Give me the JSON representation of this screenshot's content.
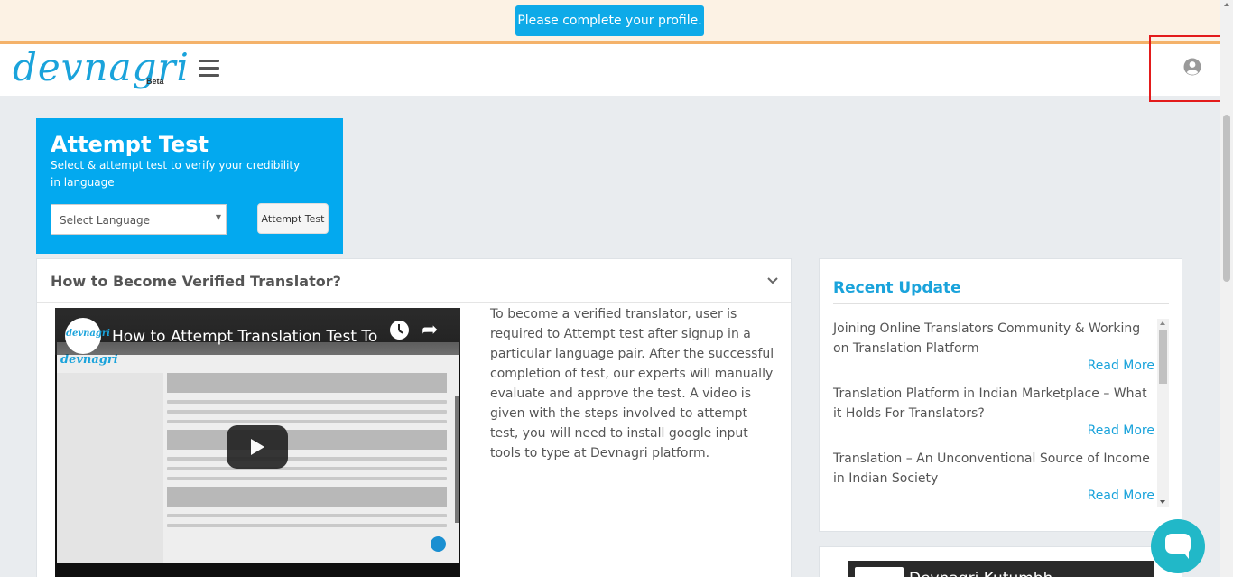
{
  "notice": {
    "button_label": "Please complete your profile."
  },
  "header": {
    "logo_text": "devnagri",
    "logo_badge": "Beta",
    "menu_icon": "hamburger-menu-icon",
    "profile_icon": "user-avatar-icon"
  },
  "attempt_test": {
    "title": "Attempt Test",
    "subtitle": "Select & attempt test to verify your credibility in language",
    "select_placeholder": "Select Language",
    "button_label": "Attempt Test"
  },
  "howto": {
    "title": "How to Become Verified Translator?",
    "chevron_icon": "chevron-down-icon",
    "video": {
      "title": "How to Attempt Translation Test To",
      "channel_logo": "devnagri"
    },
    "description": "To become a verified translator, user is required to Attempt test after signup in a particular language pair. After the successful completion of test, our experts will manually evaluate and approve the test. A video is given with the steps involved to attempt test, you will need to install google input tools to type at Devnagri platform."
  },
  "recent_update": {
    "title": "Recent Update",
    "items": [
      {
        "title": "Joining Online Translators Community & Working on Translation Platform",
        "link": "Read More"
      },
      {
        "title": "Translation Platform in Indian Marketplace – What it Holds For Translators?",
        "link": "Read More"
      },
      {
        "title": "Translation – An Unconventional Source of Income in Indian Society",
        "link": "Read More"
      }
    ]
  },
  "kutumbh": {
    "video_title": "Devnagri Kutumbh"
  },
  "colors": {
    "accent": "#03a9ef",
    "notice_bg": "#fcf2e4",
    "notice_line": "#f4b26a",
    "highlight": "#e31b1b",
    "chat": "#21b8c8"
  }
}
